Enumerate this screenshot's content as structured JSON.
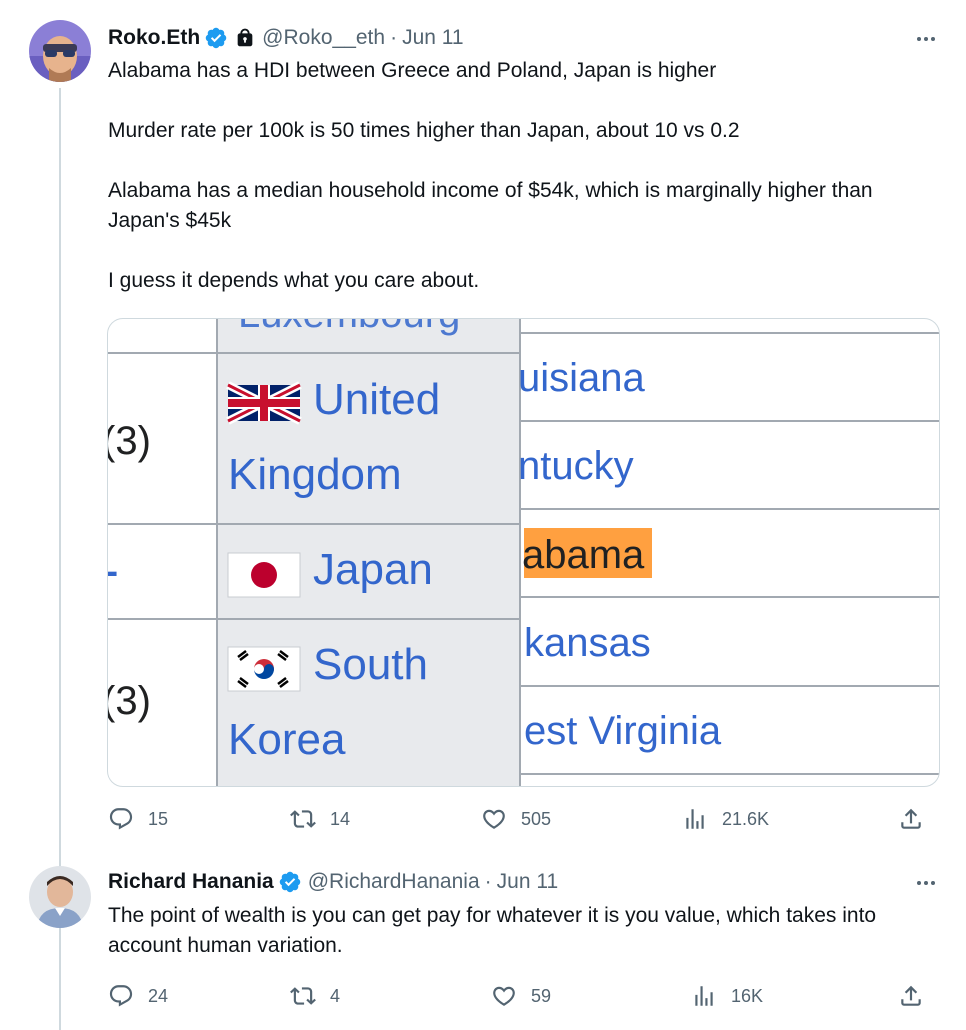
{
  "tweets": [
    {
      "display_name": "Roko.Eth",
      "handle": "@Roko__eth",
      "separator": "·",
      "date": "Jun 11",
      "paragraphs": [
        "Alabama has a HDI between Greece and Poland, Japan is higher",
        "Murder rate per 100k is 50 times higher than Japan, about 10 vs 0.2",
        "Alabama has a median household income of $54k, which is marginally higher than Japan's $45k",
        "I guess it depends what you care about."
      ],
      "replies": "15",
      "reposts": "14",
      "likes": "505",
      "views": "21.6K"
    },
    {
      "display_name": "Richard Hanania",
      "handle": "@RichardHanania",
      "separator": "·",
      "date": "Jun 11",
      "paragraphs": [
        "The point of wealth is you can get pay for whatever it is you value, which takes into account human variation."
      ],
      "replies": "24",
      "reposts": "4",
      "likes": "59",
      "views": "16K"
    }
  ],
  "media": {
    "rank_top": "(3)",
    "rank_bottom": "(3)",
    "country_uk_1": "United",
    "country_uk_2": "Kingdom",
    "country_jp": "Japan",
    "country_kr_1": "South",
    "country_kr_2": "Korea",
    "state_1": "uisiana",
    "state_2": "ntucky",
    "state_3": "abama",
    "state_4": "kansas",
    "state_5": "est Virginia",
    "dash": "-"
  },
  "colors": {
    "link_blue": "#3366cc",
    "highlight": "#ffa040",
    "grey_column": "#e8eaed",
    "verified": "#1d9bf0"
  }
}
